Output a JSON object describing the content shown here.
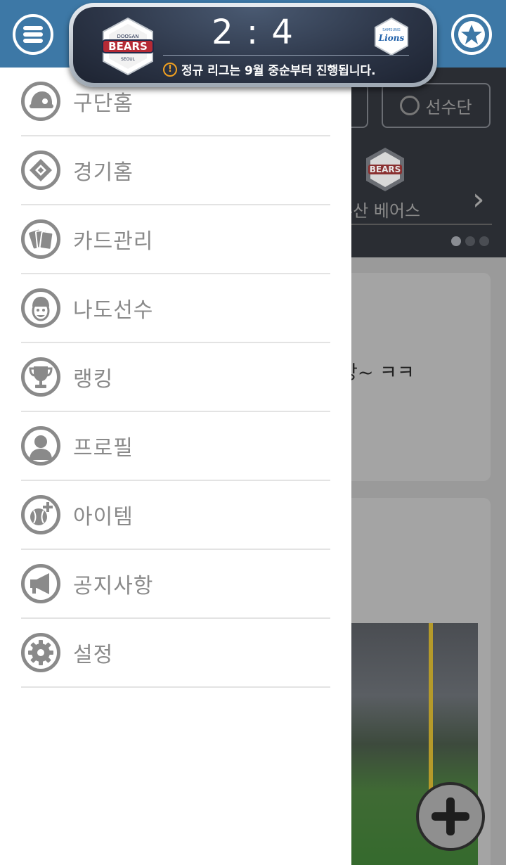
{
  "header": {
    "menu_icon": "hamburger-menu-icon",
    "favorite_icon": "star-icon",
    "accent_color": "#3d78a6"
  },
  "scoreboard": {
    "home_team_logo": "BEARS",
    "home_team_logo_top": "DOOSAN",
    "home_team_logo_bottom": "SEOUL",
    "away_team_logo": "Lions",
    "away_team_logo_top": "SAMSUNG",
    "score": "2 : 4",
    "notice": "정규 리그는 9월 중순부터 진행됩니다.",
    "notice_icon": "warning-icon"
  },
  "drawer": {
    "items": [
      {
        "label": "구단홈",
        "icon": "helmet-icon"
      },
      {
        "label": "경기홈",
        "icon": "baseball-diamond-icon"
      },
      {
        "label": "카드관리",
        "icon": "cards-icon"
      },
      {
        "label": "나도선수",
        "icon": "player-face-icon"
      },
      {
        "label": "랭킹",
        "icon": "trophy-icon"
      },
      {
        "label": "프로필",
        "icon": "user-icon"
      },
      {
        "label": "아이템",
        "icon": "baseball-plus-icon"
      },
      {
        "label": "공지사항",
        "icon": "megaphone-icon"
      },
      {
        "label": "설정",
        "icon": "gear-icon"
      }
    ]
  },
  "background": {
    "tab_players": "선수단",
    "team_name": "두산 베어스",
    "card_text": "당~ ㅋㅋ",
    "team_logo": "BEARS"
  }
}
